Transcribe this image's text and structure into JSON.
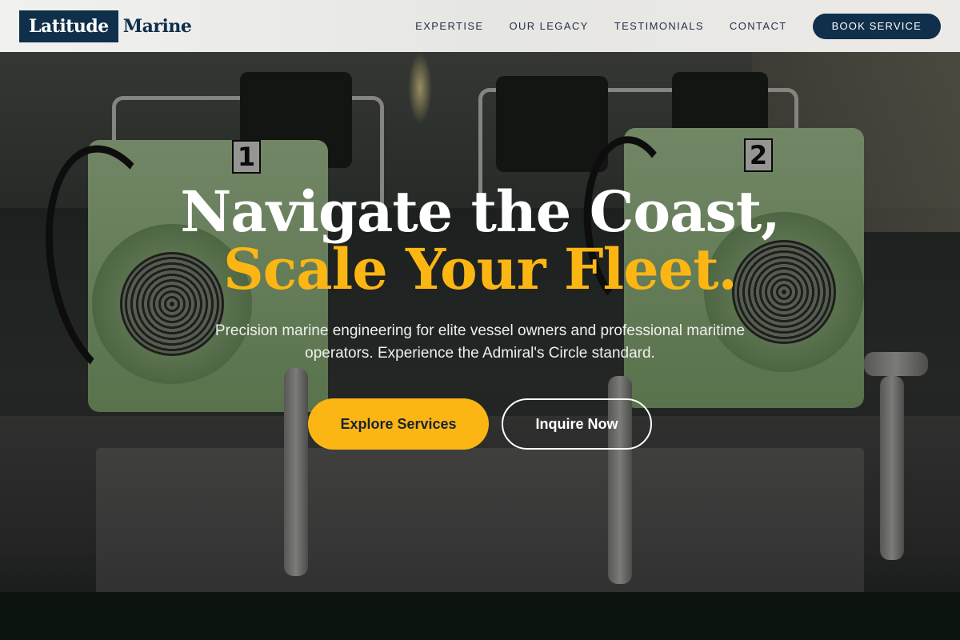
{
  "brand": {
    "logo_box_text": "Latitude",
    "logo_word_text": "Marine"
  },
  "nav": {
    "items": [
      {
        "label": "EXPERTISE"
      },
      {
        "label": "OUR LEGACY"
      },
      {
        "label": "TESTIMONIALS"
      },
      {
        "label": "CONTACT"
      }
    ],
    "book_button_label": "BOOK SERVICE"
  },
  "hero": {
    "headline_line1": "Navigate the Coast,",
    "headline_line2": "Scale Your Fleet.",
    "subtitle": "Precision marine engineering for elite vessel owners and professional maritime operators. Experience the Admiral's Circle standard.",
    "cta_primary": "Explore Services",
    "cta_secondary": "Inquire Now",
    "background_plates": {
      "left": "1",
      "right": "2"
    }
  },
  "colors": {
    "navy": "#0f2f4a",
    "accent_gold": "#fbb614",
    "header_bg": "#efefed"
  }
}
